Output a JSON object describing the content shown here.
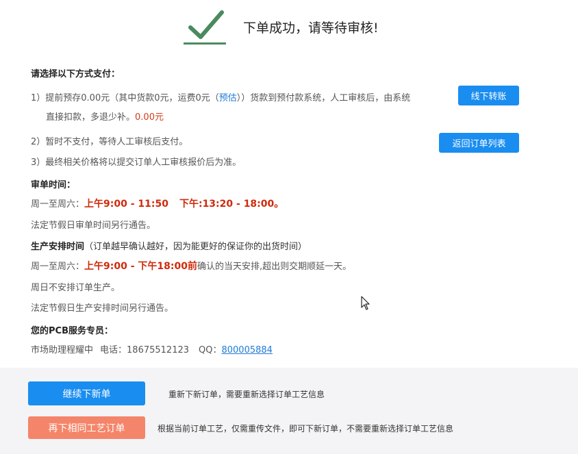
{
  "header": {
    "title": "下单成功，请等待审核!"
  },
  "payment": {
    "heading": "请选择以下方式支付：",
    "item1": {
      "prefix": "1）提前预存",
      "amount": "0.00元",
      "mid1": "（其中货款0元，运费0元（",
      "estimate_link": "预估",
      "mid2": "））货款到预付款系统，人工审核后，由系统",
      "line2": "直接扣款，多退少补。",
      "refund_amount": "0.00元"
    },
    "item2": "2）暂时不支付，等待人工审核后支付。",
    "item3": "3）最终相关价格将以提交订单人工审核报价后为准。",
    "offline_transfer_button": "线下转账",
    "back_to_orders_button": "返回订单列表"
  },
  "review_time": {
    "heading": "审单时间：",
    "weekday_prefix": "周一至周六：",
    "morning": "上午9:00 - 11:50",
    "afternoon": "下午:13:20 - 18:00。",
    "holiday_note": "法定节假日审单时间另行通告。"
  },
  "production": {
    "heading": "生产安排时间",
    "heading_note": "（订单越早确认越好，因为能更好的保证你的出货时间）",
    "weekday_prefix": "周一至周六：",
    "time_range": "上午9:00 - 下午18:00前",
    "suffix": "确认的当天安排,超出则交期顺延一天。",
    "sunday_note": "周日不安排订单生产。",
    "holiday_note": "法定节假日生产安排时间另行通告。"
  },
  "service": {
    "heading": "您的PCB服务专员：",
    "name": "市场助理程耀中",
    "phone_label": "电话：",
    "phone": "18675512123",
    "qq_label": "QQ：",
    "qq": "800005884"
  },
  "actions": {
    "new_order_button": "继续下新单",
    "new_order_desc": "重新下新订单，需要重新选择订单工艺信息",
    "same_process_button": "再下相同工艺订单",
    "same_process_desc": "根据当前订单工艺，仅需重传文件，即可下新订单，不需要重新选择订单工艺信息"
  },
  "colors": {
    "primary_blue": "#1a8df0",
    "accent_orange": "#f4856a",
    "check_green": "#4a8a5e",
    "price_red": "#d02a0c"
  },
  "icons": [
    "check-icon",
    "mouse-cursor-icon"
  ]
}
